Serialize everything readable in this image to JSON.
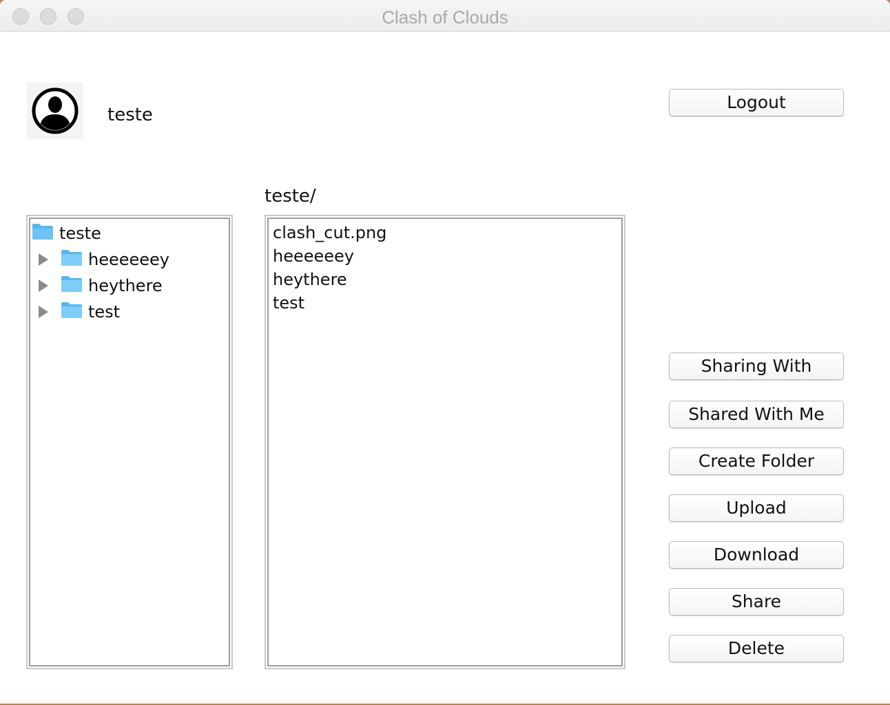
{
  "window": {
    "title": "Clash of Clouds"
  },
  "user": {
    "name": "teste",
    "avatar_icon": "user-avatar-icon"
  },
  "path": "teste/",
  "tree": {
    "root": "teste",
    "children": [
      "heeeeeey",
      "heythere",
      "test"
    ]
  },
  "files": [
    "clash_cut.png",
    "heeeeeey",
    "heythere",
    "test"
  ],
  "buttons": {
    "logout": "Logout",
    "sharing_with": "Sharing With",
    "shared_with_me": "Shared With Me",
    "create_folder": "Create Folder",
    "upload": "Upload",
    "download": "Download",
    "share": "Share",
    "delete": "Delete"
  },
  "colors": {
    "folder": "#6cc3f5",
    "folder_tab": "#5bb4ea"
  }
}
